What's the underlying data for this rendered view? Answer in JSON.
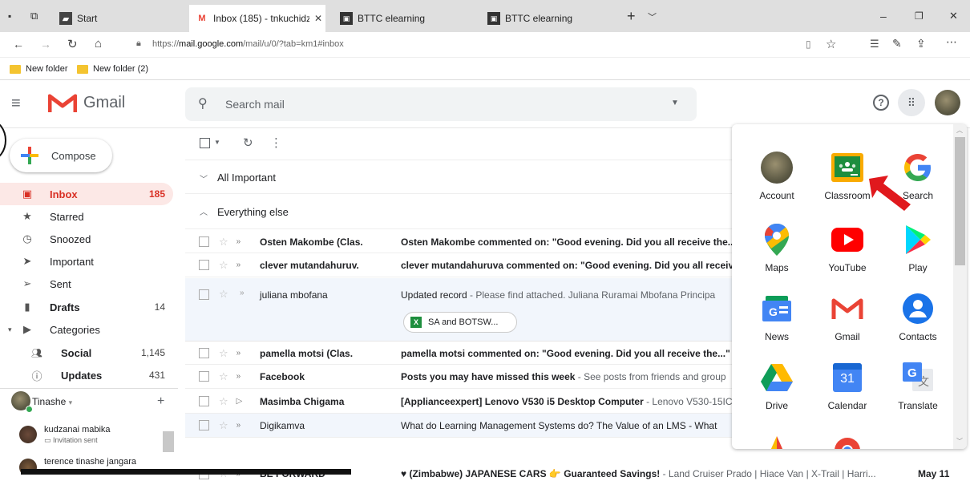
{
  "browser": {
    "tabs": [
      {
        "label": "Start"
      },
      {
        "label": "Inbox (185) - tnkuchidz"
      },
      {
        "label": "BTTC elearning"
      },
      {
        "label": "BTTC elearning"
      }
    ],
    "url_prefix": "https://",
    "url_host": "mail.google.com",
    "url_path": "/mail/u/0/?tab=km1#inbox",
    "bookmarks": [
      "New folder",
      "New folder (2)"
    ]
  },
  "gmail": {
    "logo_text": "Gmail",
    "search_placeholder": "Search mail",
    "compose_label": "Compose",
    "nav": [
      {
        "label": "Inbox",
        "count": "185"
      },
      {
        "label": "Starred",
        "count": ""
      },
      {
        "label": "Snoozed",
        "count": ""
      },
      {
        "label": "Important",
        "count": ""
      },
      {
        "label": "Sent",
        "count": ""
      },
      {
        "label": "Drafts",
        "count": "14"
      },
      {
        "label": "Categories",
        "count": ""
      },
      {
        "label": "Social",
        "count": "1,145"
      },
      {
        "label": "Updates",
        "count": "431"
      }
    ],
    "hangouts_user": "Tinashe",
    "contacts": [
      {
        "name": "kudzanai mabika",
        "status": "Invitation sent"
      },
      {
        "name": "terence tinashe jangara",
        "status": ""
      }
    ],
    "sections": {
      "important": "All Important",
      "else": "Everything else"
    },
    "emails": [
      {
        "sender": "Osten Makombe (Clas.",
        "subject": "Osten Makombe commented on: \"Good evening. Did you all receive the...\"",
        "snippet": ""
      },
      {
        "sender": "clever mutandahuruv.",
        "subject": "clever mutandahuruva commented on: \"Good evening. Did you all receive",
        "snippet": ""
      },
      {
        "sender": "juliana mbofana",
        "subject": "Updated record",
        "snippet": " - Please find attached. Juliana Ruramai Mbofana Principa",
        "attachment": "SA and BOTSW..."
      },
      {
        "sender": "pamella motsi (Clas.",
        "subject": "pamella motsi commented on: \"Good evening. Did you all receive the...\"",
        "snippet": " -"
      },
      {
        "sender": "Facebook",
        "subject": "Posts you may have missed this week",
        "snippet": " - See posts from friends and group"
      },
      {
        "sender": "Masimba Chigama",
        "subject": "[Applianceexpert] Lenovo V530 i5 Desktop Computer",
        "snippet": " - Lenovo V530-15IC"
      },
      {
        "sender": "Digikamva",
        "subject": "What do Learning Management Systems do? The Value of an LMS - What",
        "snippet": ""
      },
      {
        "sender": "BE FORWARD",
        "subject": "♥ (Zimbabwe) JAPANESE CARS 👉 Guaranteed Savings!",
        "snippet": " - Land Cruiser Prado | Hiace Van | X-Trail | Harri...",
        "date": "May 11"
      }
    ],
    "apps": [
      {
        "label": "Account",
        "icon": "account-icon"
      },
      {
        "label": "Classroom",
        "icon": "classroom-icon"
      },
      {
        "label": "Search",
        "icon": "google-icon"
      },
      {
        "label": "Maps",
        "icon": "maps-icon"
      },
      {
        "label": "YouTube",
        "icon": "youtube-icon"
      },
      {
        "label": "Play",
        "icon": "play-icon"
      },
      {
        "label": "News",
        "icon": "news-icon"
      },
      {
        "label": "Gmail",
        "icon": "gmail-icon"
      },
      {
        "label": "Contacts",
        "icon": "contacts-icon"
      },
      {
        "label": "Drive",
        "icon": "drive-icon"
      },
      {
        "label": "Calendar",
        "icon": "calendar-icon",
        "badge": "31"
      },
      {
        "label": "Translate",
        "icon": "translate-icon"
      }
    ]
  },
  "colors": {
    "inbox_red": "#d93025",
    "arrow_red": "#e0191d",
    "gmail_red": "#ea4335"
  }
}
